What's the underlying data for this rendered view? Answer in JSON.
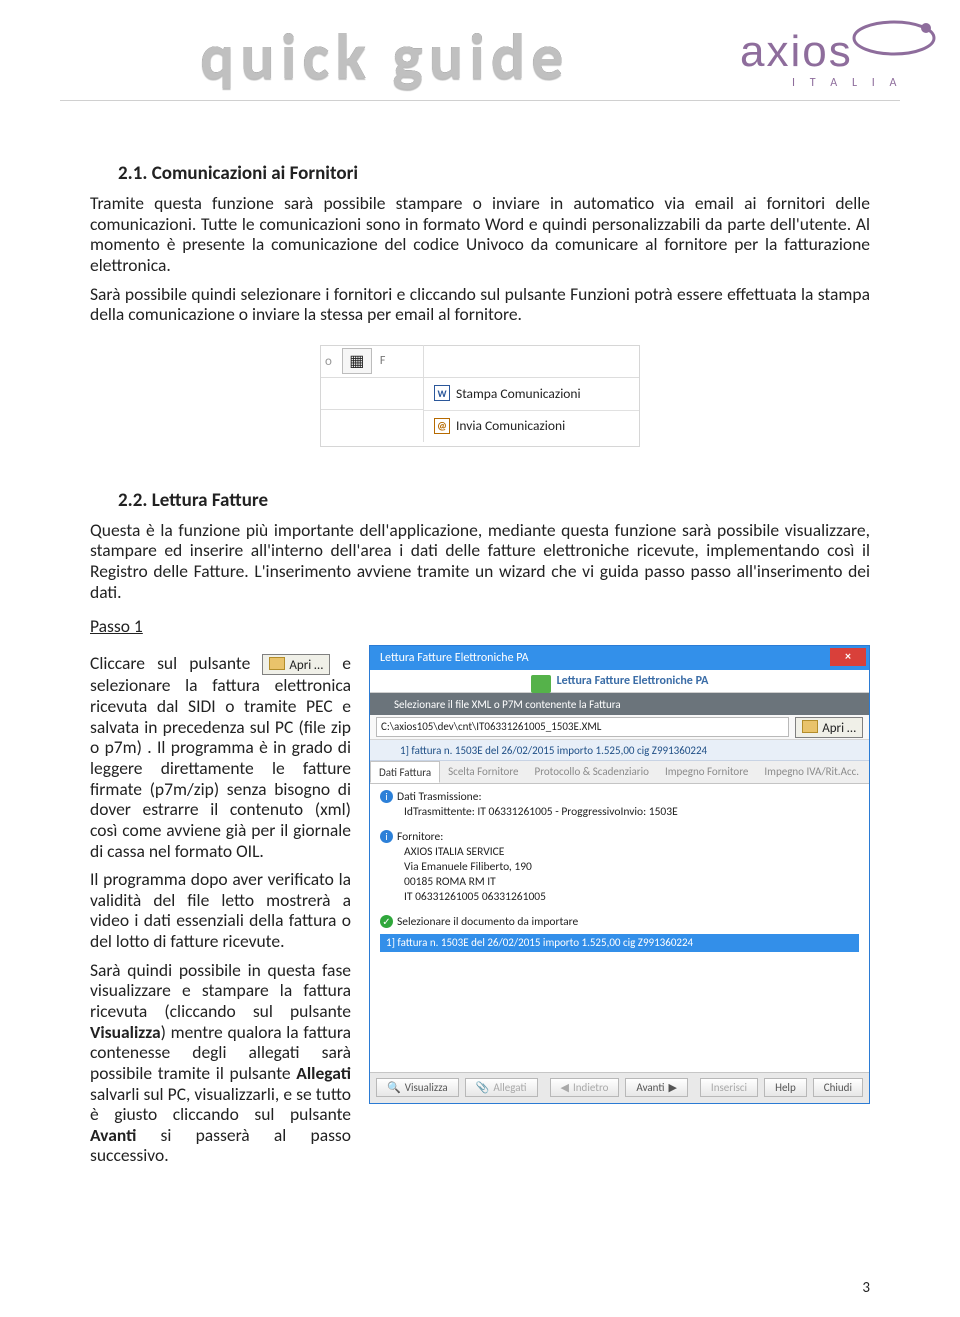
{
  "header": {
    "title": "quick guide",
    "brand": "axios",
    "brand_sub": "I T A L I A"
  },
  "s21": {
    "heading": "2.1. Comunicazioni ai Fornitori",
    "p1": "Tramite questa funzione sarà possibile stampare o inviare in automatico via email ai fornitori delle comunicazioni. Tutte le comunicazioni sono in formato Word e quindi personalizzabili da parte dell'utente. Al momento è presente la comunicazione del codice Univoco da comunicare al fornitore per la fatturazione elettronica.",
    "p2": "Sarà possibile quindi selezionare i fornitori e cliccando sul pulsante Funzioni potrà essere effettuata la stampa della comunicazione o inviare la stessa per email al fornitore.",
    "menu": {
      "m1": "Stampa Comunicazioni",
      "m2": "Invia Comunicazioni"
    }
  },
  "s22": {
    "heading": "2.2. Lettura Fatture",
    "p1": "Questa è la funzione più importante dell'applicazione, mediante questa funzione sarà possibile visualizzare, stampare ed inserire all'interno dell'area i dati delle fatture elettroniche ricevute, implementando così il Registro delle Fatture. L'inserimento avviene tramite un wizard che vi guida passo passo all'inserimento dei dati.",
    "step": "Passo 1",
    "left": {
      "p1a": "Cliccare sul pulsante ",
      "apri": "Apri …",
      "p1b": " e selezionare la fattura elettronica ricevuta dal SIDI o tramite PEC e salvata in precedenza sul PC (file zip o p7m) . Il programma è in grado di leggere direttamente le fatture firmate (p7m/zip) senza bisogno di dover estrarre il contenuto (xml) così come avviene già per il giornale di cassa nel formato OIL.",
      "p2": "Il programma dopo aver verificato la validità del file letto mostrerà a video i dati essenziali della fattura o del lotto di fatture ricevute.",
      "p3a": "Sarà quindi possibile in questa fase visualizzare e stampare la fattura ricevuta (cliccando sul pulsante ",
      "p3b_bold": "Visualizza",
      "p3c": ") mentre qualora la fattura contenesse degli allegati sarà possibile tramite il pulsante ",
      "p3d_bold": "Allegati",
      "p3e": " salvarli sul PC, visualizzarli, e se tutto è giusto cliccando sul pulsante ",
      "p3f_bold": "Avanti",
      "p3g": " si passerà al passo successivo."
    }
  },
  "dlg": {
    "title": "Lettura Fatture Elettroniche PA",
    "sub": "Lettura Fatture Elettroniche PA",
    "hint": "Selezionare il file XML o P7M contenente la Fattura",
    "path": "C:\\axios105\\dev\\cnt\\IT06331261005_1503E.XML",
    "apri": "Apri …",
    "summary": "1] fattura n. 1503E del 26/02/2015 importo 1.525,00 cig Z991360224",
    "tabs": {
      "t1": "Dati Fattura",
      "t2": "Scelta Fornitore",
      "t3": "Protocollo & Scadenziario",
      "t4": "Impegno Fornitore",
      "t5": "Impegno IVA/Rit.Acc."
    },
    "panel": {
      "l1": "Dati Trasmissione:",
      "l2": "IdTrasmittente: IT 06331261005 - ProggressivoInvio: 1503E",
      "l3": "Fornitore:",
      "l4": "AXIOS ITALIA SERVICE",
      "l5": "Via Emanuele Filiberto, 190",
      "l6": "00185 ROMA RM IT",
      "l7": "IT 06331261005 06331261005",
      "l8": "Selezionare il documento da importare",
      "l9": "1] fattura n. 1503E del 26/02/2015 importo 1.525,00 cig Z991360224"
    },
    "buttons": {
      "vis": "Visualizza",
      "all": "Allegati",
      "back": "Indietro",
      "next": "Avanti",
      "ins": "Inserisci",
      "help": "Help",
      "close": "Chiudi"
    }
  },
  "page": "3"
}
